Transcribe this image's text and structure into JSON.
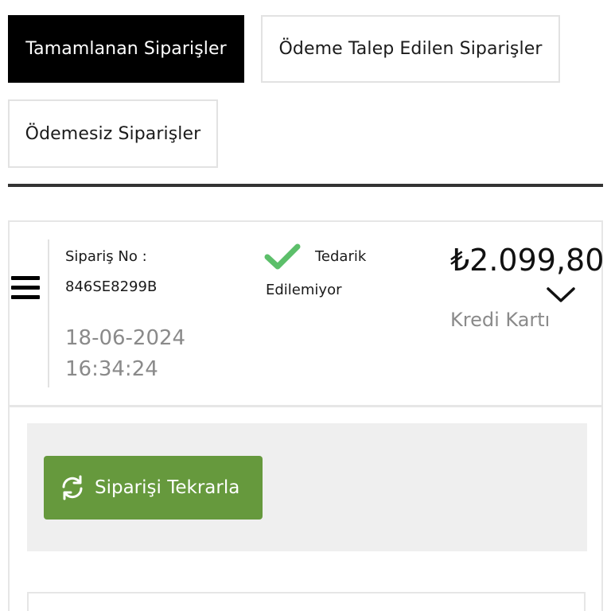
{
  "tabs": [
    {
      "label": "Tamamlanan Siparişler",
      "active": true
    },
    {
      "label": "Ödeme Talep Edilen Siparişler",
      "active": false
    },
    {
      "label": "Ödemesiz Siparişler",
      "active": false
    }
  ],
  "order": {
    "number_label": "Sipariş No :",
    "number": "846SE8299B",
    "date": "18-06-2024",
    "time": "16:34:24",
    "status_line1": "Tedarik",
    "status_line2": "Edilemiyor",
    "amount": "₺2.099,80",
    "payment_method": "Kredi Kartı"
  },
  "actions": {
    "reorder_label": "Siparişi Tekrarla"
  },
  "icons": {
    "menu": "hamburger-icon",
    "status": "check-icon",
    "expand": "chevron-down-icon",
    "reorder": "refresh-icon"
  },
  "colors": {
    "active_tab_bg": "#000000",
    "check_green": "#5cbf6a",
    "button_green": "#66993d",
    "panel_gray": "#efefef",
    "muted_text": "#8a8a8a"
  }
}
